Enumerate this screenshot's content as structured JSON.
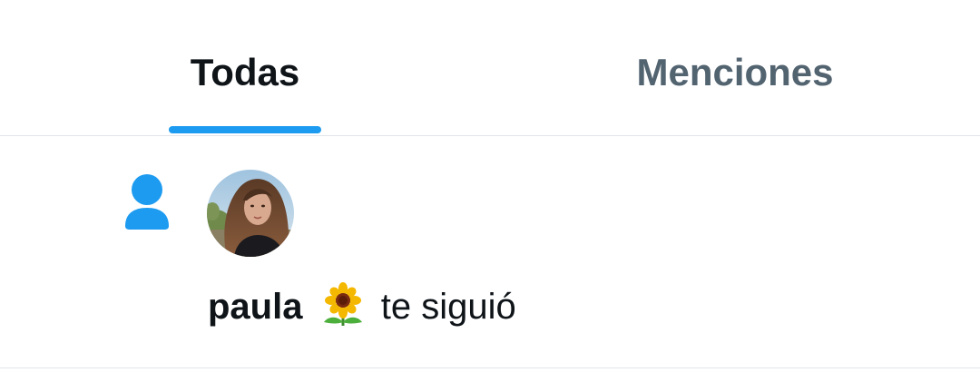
{
  "tabs": {
    "all_label": "Todas",
    "mentions_label": "Menciones",
    "active": "Todas"
  },
  "notification": {
    "type_icon": "person-follow-icon",
    "avatar": "user-avatar-photo",
    "user_name": "paula",
    "emoji_icon": "sunflower-icon",
    "action_text": "te siguió"
  },
  "colors": {
    "accent": "#1d9bf0",
    "primary_text": "#0f1419",
    "secondary_text": "#536471",
    "divider": "#e1e6ea"
  }
}
